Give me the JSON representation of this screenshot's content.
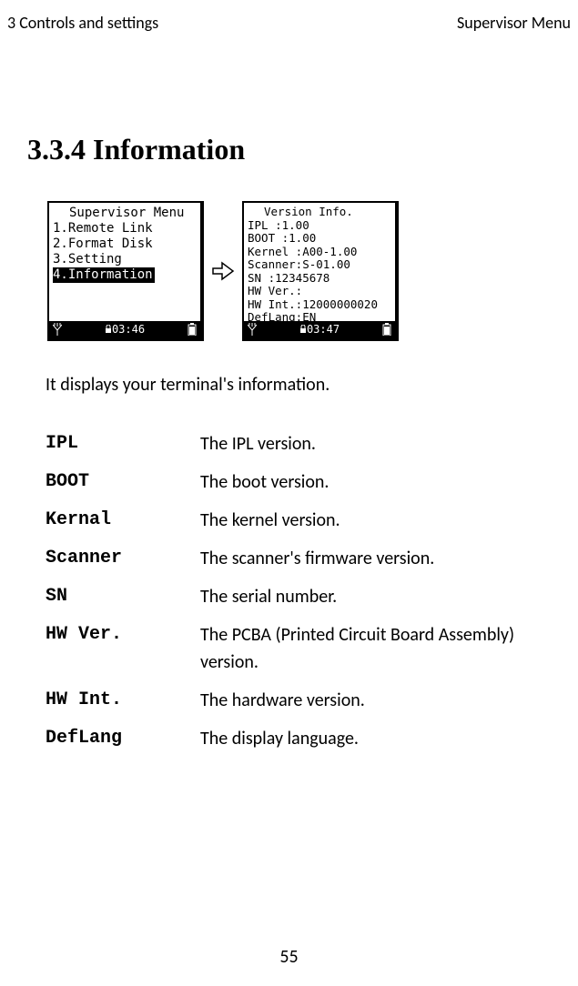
{
  "header": {
    "left": "3 Controls and settings",
    "right": "Supervisor Menu"
  },
  "heading": "3.3.4  Information",
  "screens": {
    "left": {
      "title": "Supervisor Menu",
      "item1": "1.Remote Link",
      "item2": "2.Format Disk",
      "item3": "3.Setting",
      "item4_highlight": "4.Information",
      "time": "03:46"
    },
    "right": {
      "title": "Version Info.",
      "l1": "IPL    :1.00",
      "l2": "BOOT   :1.00",
      "l3": "Kernel :A00-1.00",
      "l4": "Scanner:S-01.00",
      "l5": "SN     :12345678",
      "l6": "HW Ver.:",
      "l7": "HW Int.:12000000020",
      "l8": "DefLang:EN",
      "time": "03:47"
    }
  },
  "intro": "It displays your terminal's information.",
  "defs": {
    "r1": {
      "term": "IPL",
      "desc": "The IPL version."
    },
    "r2": {
      "term": "BOOT",
      "desc": "The boot version."
    },
    "r3": {
      "term": "Kernal",
      "desc": "The kernel version."
    },
    "r4": {
      "term": "Scanner",
      "desc": "The scanner's firmware version."
    },
    "r5": {
      "term": "SN",
      "desc": "The serial number."
    },
    "r6": {
      "term": "HW Ver.",
      "desc": "The PCBA (Printed Circuit Board Assembly) version."
    },
    "r7": {
      "term": "HW Int.",
      "desc": "The hardware version."
    },
    "r8": {
      "term": "DefLang",
      "desc": "The display language."
    }
  },
  "page_number": "55"
}
